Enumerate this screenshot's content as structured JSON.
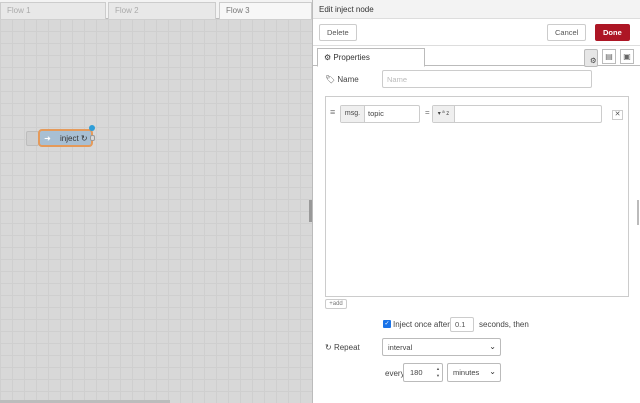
{
  "workspace": {
    "tabs": [
      "Flow 1",
      "Flow 2",
      "Flow 3"
    ],
    "active_tab": "Flow 3",
    "node": {
      "label": "inject ↻"
    }
  },
  "tray": {
    "title": "Edit inject node",
    "delete_label": "Delete",
    "cancel_label": "Cancel",
    "done_label": "Done",
    "properties_tab": "Properties",
    "name_label": "Name",
    "name_placeholder": "Name",
    "property": {
      "prefix": "msg.",
      "key": "topic",
      "eq": "=",
      "type_symbol": "ª z"
    },
    "add_label": "+add",
    "inject_once_label": "Inject once after",
    "inject_once_value": "0.1",
    "seconds_then": "seconds, then",
    "repeat_label": "Repeat",
    "repeat_value": "interval",
    "every_label": "every",
    "every_value": "180",
    "units_value": "minutes"
  },
  "colors": {
    "done_button": "#ad1625",
    "node_fill": "#a8bfd3",
    "node_border": "#e59a5a",
    "changed_dot": "#2f9ed8"
  }
}
